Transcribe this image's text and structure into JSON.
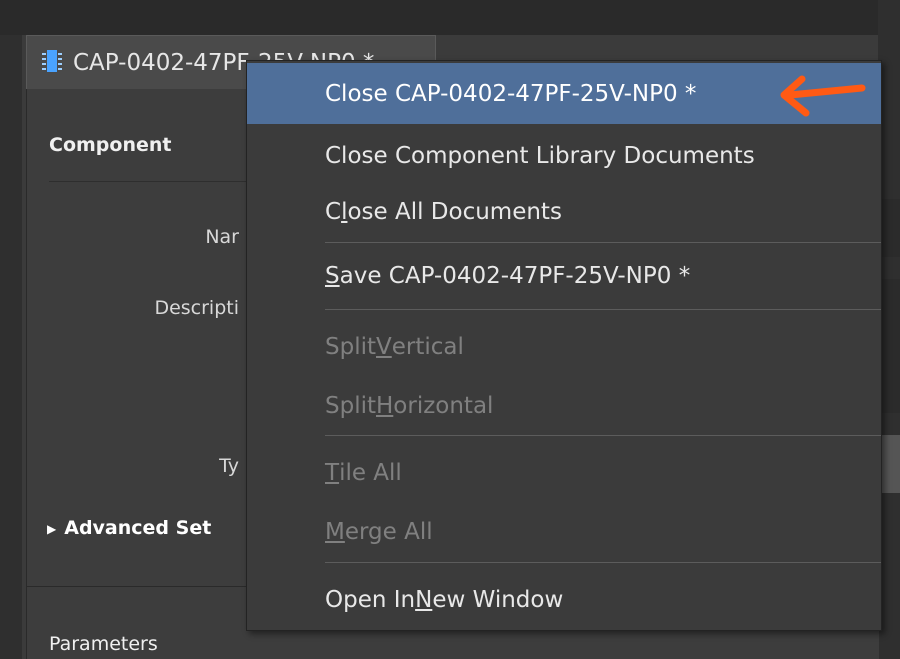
{
  "tab": {
    "title": "CAP-0402-47PF-25V-NP0 *"
  },
  "panel": {
    "section_component": "Component",
    "name_label": "Nar",
    "description_label": "Descripti",
    "type_label": "Ty",
    "advanced_label": "Advanced Set",
    "parameters_label": "Parameters"
  },
  "menu": {
    "items": [
      {
        "pre": "Close CAP-0402-47PF-25V-NP0 *",
        "u": "",
        "post": "",
        "state": "highlighted"
      },
      {
        "pre": "Close Component Library Documents",
        "u": "",
        "post": "",
        "state": "enabled"
      },
      {
        "pre": "C",
        "u": "l",
        "post": "ose All Documents",
        "state": "enabled"
      },
      {
        "pre": "",
        "u": "S",
        "post": "ave CAP-0402-47PF-25V-NP0 *",
        "state": "enabled"
      },
      {
        "pre": "Split ",
        "u": "V",
        "post": "ertical",
        "state": "disabled"
      },
      {
        "pre": "Split ",
        "u": "H",
        "post": "orizontal",
        "state": "disabled"
      },
      {
        "pre": "",
        "u": "T",
        "post": "ile All",
        "state": "disabled"
      },
      {
        "pre": "",
        "u": "M",
        "post": "erge All",
        "state": "disabled"
      },
      {
        "pre": "Open In ",
        "u": "N",
        "post": "ew Window",
        "state": "enabled"
      }
    ]
  },
  "icons": {
    "tab_icon": "component-icon",
    "annotation": "arrow-pointer-icon"
  },
  "colors": {
    "highlight": "#4f6f9a",
    "annotation_arrow": "#ff5a14",
    "tab_icon": "#4aa3ff"
  }
}
